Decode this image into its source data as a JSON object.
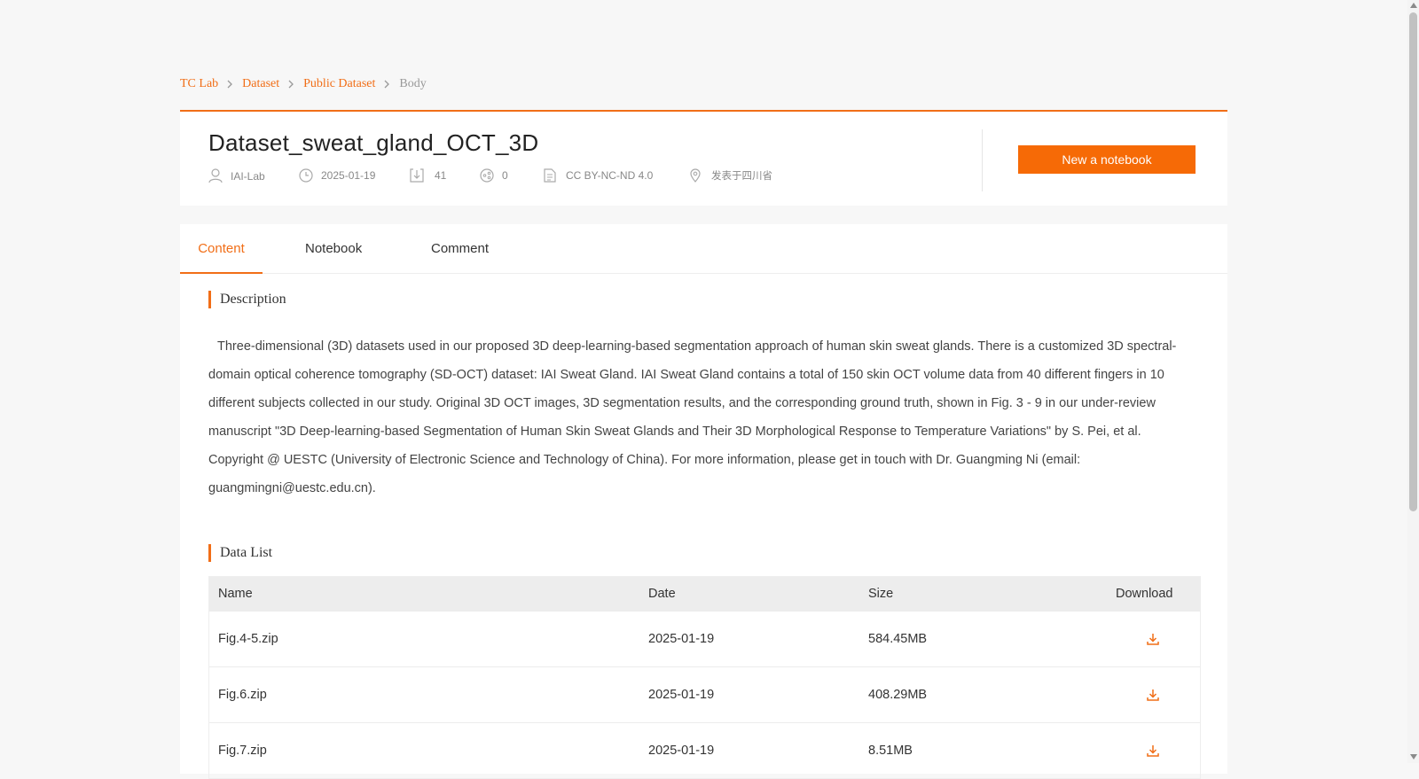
{
  "breadcrumb": {
    "items": [
      "TC Lab",
      "Dataset",
      "Public Dataset"
    ],
    "current": "Body"
  },
  "dataset": {
    "title": "Dataset_sweat_gland_OCT_3D",
    "author": "IAI-Lab",
    "date": "2025-01-19",
    "downloads": "41",
    "shares": "0",
    "license": "CC BY-NC-ND 4.0",
    "location": "发表于四川省"
  },
  "actions": {
    "new_notebook": "New a notebook"
  },
  "tabs": [
    {
      "label": "Content",
      "active": true
    },
    {
      "label": "Notebook",
      "active": false
    },
    {
      "label": "Comment",
      "active": false
    }
  ],
  "description": {
    "heading": "Description",
    "text": "Three-dimensional (3D) datasets used in our proposed 3D deep-learning-based segmentation approach of human skin sweat glands. There is a customized 3D spectral-domain optical coherence tomography (SD-OCT) dataset: IAI Sweat Gland. IAI Sweat Gland contains a total of 150 skin OCT volume data from 40 different fingers in 10 different subjects collected in our study. Original 3D OCT images, 3D segmentation results, and the corresponding ground truth, shown in Fig. 3 - 9 in our under-review manuscript \"3D Deep-learning-based Segmentation of Human Skin Sweat Glands and Their 3D Morphological Response to Temperature Variations\" by S. Pei, et al. Copyright @ UESTC (University of Electronic Science and Technology of China). For more information, please get in touch with Dr. Guangming Ni (email: guangmingni@uestc.edu.cn)."
  },
  "data_list": {
    "heading": "Data List",
    "columns": [
      "Name",
      "Date",
      "Size",
      "Download"
    ],
    "rows": [
      {
        "name": "Fig.4-5.zip",
        "date": "2025-01-19",
        "size": "584.45MB"
      },
      {
        "name": "Fig.6.zip",
        "date": "2025-01-19",
        "size": "408.29MB"
      },
      {
        "name": "Fig.7.zip",
        "date": "2025-01-19",
        "size": "8.51MB"
      }
    ]
  },
  "colors": {
    "accent": "#f16e17",
    "button": "#f66a06",
    "background": "#f7f7f7"
  },
  "icons": {
    "author": "user-icon",
    "date": "clock-icon",
    "downloads": "download-box-icon",
    "shares": "share-icon",
    "license": "document-icon",
    "location": "location-pin-icon",
    "row_download": "download-icon"
  }
}
